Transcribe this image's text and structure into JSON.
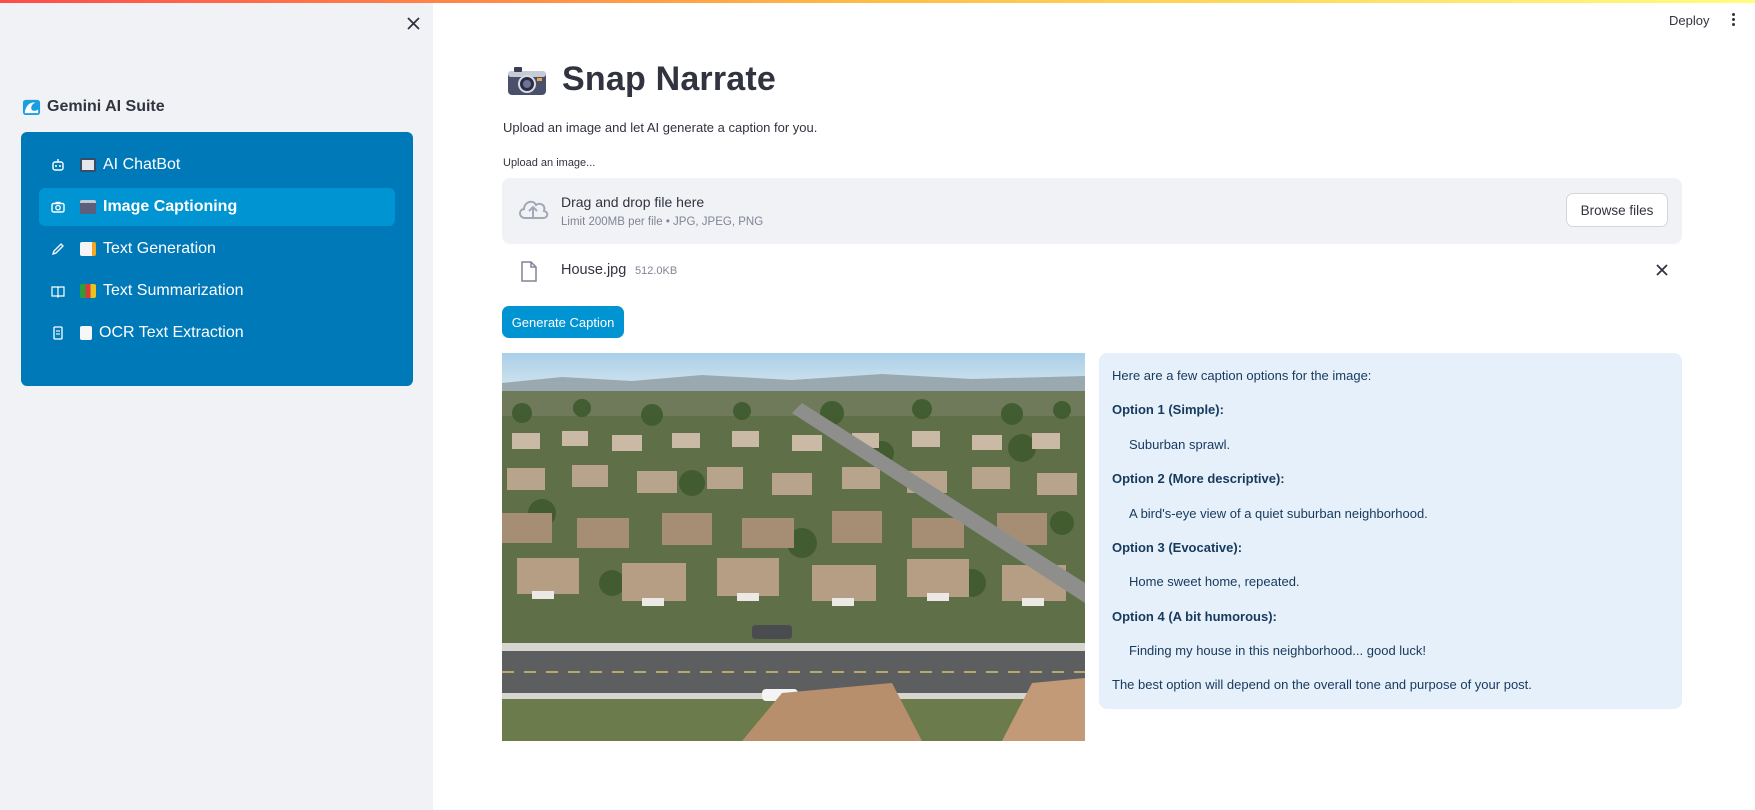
{
  "window": {
    "deploy_label": "Deploy"
  },
  "sidebar": {
    "brand": "Gemini AI Suite",
    "items": [
      {
        "label": "AI ChatBot",
        "icon": "robot-icon",
        "active": false
      },
      {
        "label": "Image Captioning",
        "icon": "camera-icon",
        "active": true
      },
      {
        "label": "Text Generation",
        "icon": "pencil-icon",
        "active": false
      },
      {
        "label": "Text Summarization",
        "icon": "book-icon",
        "active": false
      },
      {
        "label": "OCR Text Extraction",
        "icon": "document-icon",
        "active": false
      }
    ],
    "colors": {
      "menu_bg": "#0079b9",
      "active_bg": "#0094d3"
    }
  },
  "main": {
    "title": "Snap Narrate",
    "subtitle": "Upload an image and let AI generate a caption for you.",
    "uploader": {
      "label": "Upload an image...",
      "drop_title": "Drag and drop file here",
      "drop_hint": "Limit 200MB per file • JPG, JPEG, PNG",
      "browse_label": "Browse files"
    },
    "file": {
      "name": "House.jpg",
      "size": "512.0KB"
    },
    "generate_label": "Generate Caption",
    "caption": {
      "intro": "Here are a few caption options for the image:",
      "options": [
        {
          "heading": "Option 1 (Simple):",
          "text": "Suburban sprawl."
        },
        {
          "heading": "Option 2 (More descriptive):",
          "text": "A bird's-eye view of a quiet suburban neighborhood."
        },
        {
          "heading": "Option 3 (Evocative):",
          "text": "Home sweet home, repeated."
        },
        {
          "heading": "Option 4 (A bit humorous):",
          "text": "Finding my house in this neighborhood... good luck!"
        }
      ],
      "outro": "The best option will depend on the overall tone and purpose of your post."
    },
    "accent": "#0094d3"
  }
}
